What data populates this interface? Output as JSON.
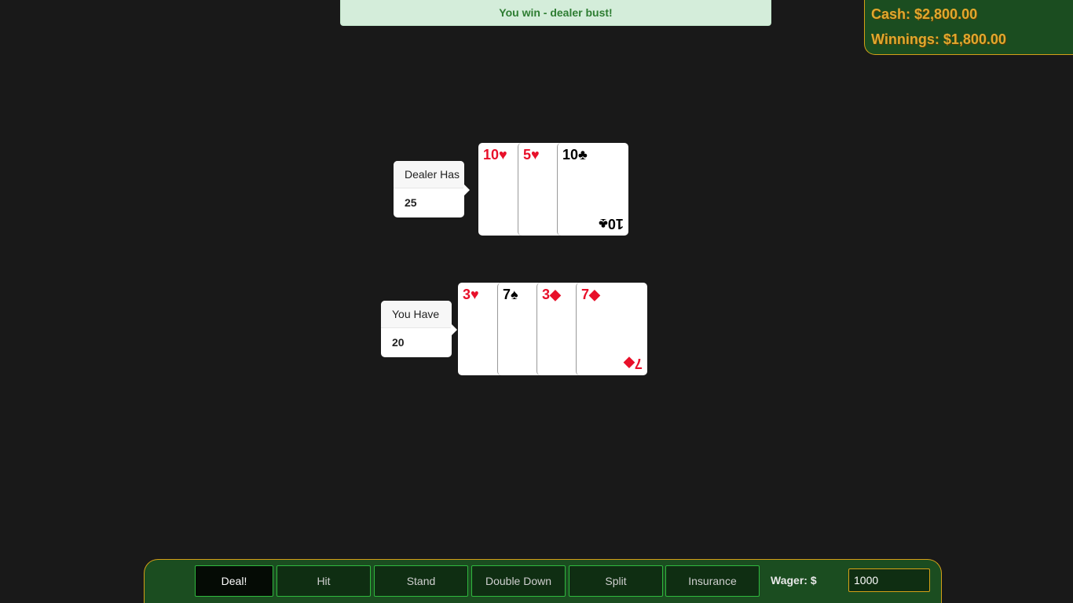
{
  "status": {
    "message": "You win - dealer bust!"
  },
  "bank": {
    "cash": "Cash: $2,800.00",
    "winnings": "Winnings: $1,800.00"
  },
  "dealer": {
    "label": "Dealer Has",
    "total": "25",
    "cards": [
      {
        "rank": "10",
        "suit": "♥",
        "color": "red"
      },
      {
        "rank": "5",
        "suit": "♥",
        "color": "red"
      },
      {
        "rank": "10",
        "suit": "♣",
        "color": "black"
      }
    ]
  },
  "player": {
    "label": "You Have",
    "total": "20",
    "cards": [
      {
        "rank": "3",
        "suit": "♥",
        "color": "red"
      },
      {
        "rank": "7",
        "suit": "♠",
        "color": "black"
      },
      {
        "rank": "3",
        "suit": "◆",
        "color": "red"
      },
      {
        "rank": "7",
        "suit": "◆",
        "color": "red"
      }
    ]
  },
  "controls": {
    "deal": "Deal!",
    "hit": "Hit",
    "stand": "Stand",
    "double_down": "Double Down",
    "split": "Split",
    "insurance": "Insurance",
    "wager_label": "Wager: $",
    "wager_value": "1000"
  },
  "colors": {
    "table": "#191919",
    "panel_green": "#1b4d20",
    "gold": "#d4a017",
    "card_red": "#e8102a"
  }
}
